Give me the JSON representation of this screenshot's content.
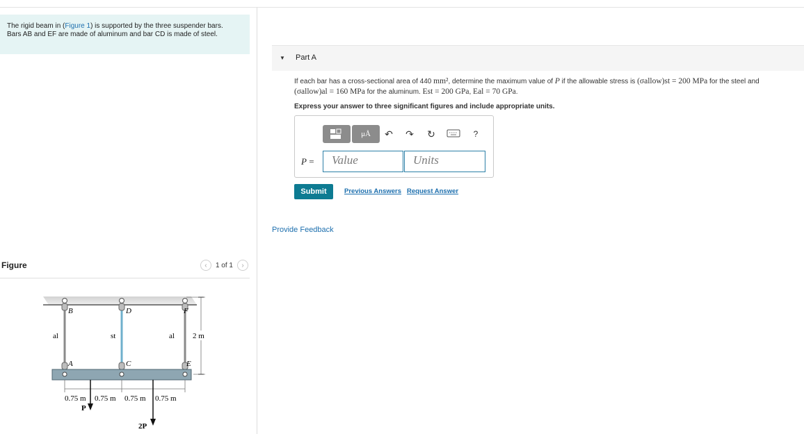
{
  "intro": {
    "line1_prefix": "The rigid beam in (",
    "figure_link": "Figure 1",
    "line1_suffix": ") is supported by the three suspender bars.",
    "line2": "Bars AB and EF are made of aluminum and bar CD is made of steel."
  },
  "figure": {
    "title": "Figure",
    "pager": "1 of 1",
    "labels": {
      "B": "B",
      "D": "D",
      "F": "F",
      "A": "A",
      "C": "C",
      "E": "E",
      "al_left": "al",
      "st": "st",
      "al_right": "al",
      "height": "2 m",
      "seg1": "0.75 m",
      "seg2": "0.75 m",
      "seg3": "0.75 m",
      "seg4": "0.75 m",
      "load1": "P",
      "load2": "2P"
    }
  },
  "part": {
    "title": "Part A",
    "q_line1_a": "If each bar has a cross-sectional area of 440 ",
    "q_area_unit": "mm²",
    "q_line1_b": ", determine the maximum value of ",
    "q_P": "P",
    "q_line1_c": " if the allowable stress is ",
    "q_st_stress": "(σallow)st = 200 MPa",
    "q_line1_d": " for the steel and",
    "q_al_stress": "(σallow)al = 160 MPa",
    "q_line2_a": " for the aluminum. ",
    "q_Est": "Est = 200 GPa",
    "q_sep": ", ",
    "q_Eal": "Eal = 70 GPa",
    "q_end": ".",
    "express": "Express your answer to three significant figures and include appropriate units."
  },
  "answer": {
    "units_tool": "μÅ",
    "help": "?",
    "p_label": "P",
    "p_equals": " =",
    "value_placeholder": "Value",
    "units_placeholder": "Units"
  },
  "actions": {
    "submit": "Submit",
    "previous": "Previous Answers",
    "request": "Request Answer",
    "feedback": "Provide Feedback"
  },
  "colors": {
    "accent": "#0d7b92",
    "link": "#1d6fae",
    "intro_bg": "#e5f4f4",
    "beam": "#8ea6b2",
    "steel_bar": "#6fb0cc"
  }
}
